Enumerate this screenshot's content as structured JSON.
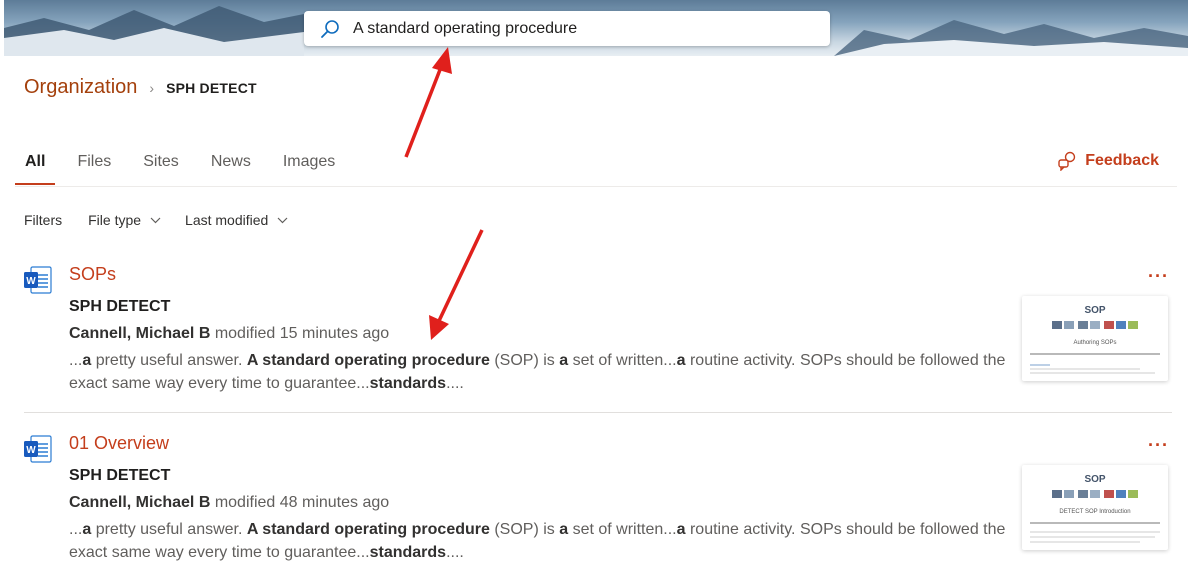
{
  "search": {
    "query": "A standard operating procedure"
  },
  "breadcrumb": {
    "root": "Organization",
    "separator": "›",
    "current": "SPH DETECT"
  },
  "tabs": [
    {
      "label": "All",
      "active": true
    },
    {
      "label": "Files",
      "active": false
    },
    {
      "label": "Sites",
      "active": false
    },
    {
      "label": "News",
      "active": false
    },
    {
      "label": "Images",
      "active": false
    }
  ],
  "feedback": {
    "label": "Feedback",
    "icon": "feedback-icon"
  },
  "filters": {
    "label": "Filters",
    "file_type": "File type",
    "last_modified": "Last modified"
  },
  "results": [
    {
      "title": "SOPs",
      "site": "SPH DETECT",
      "author": "Cannell, Michael B",
      "modified": " modified 15 minutes ago",
      "snippet_parts": [
        "...",
        "a",
        " pretty useful answer. ",
        "A standard operating procedure",
        " (SOP) is ",
        "a",
        " set of written...",
        "a",
        " routine activity. SOPs should be followed the exact same way every time to guarantee...",
        "standards",
        "...."
      ],
      "more": "···",
      "thumb_title": "SOP",
      "thumb_sub": "Authoring SOPs"
    },
    {
      "title": "01 Overview",
      "site": "SPH DETECT",
      "author": "Cannell, Michael B",
      "modified": " modified 48 minutes ago",
      "snippet_parts": [
        "...",
        "a",
        " pretty useful answer. ",
        "A standard operating procedure",
        " (SOP) is ",
        "a",
        " set of written...",
        "a",
        " routine activity. SOPs should be followed the exact same way every time to guarantee...",
        "standards",
        "...."
      ],
      "more": "···",
      "thumb_title": "SOP",
      "thumb_sub": "DETECT SOP Introduction"
    }
  ],
  "colors": {
    "accent": "#c43e1c",
    "breadcrumb": "#a4400c",
    "annotation_arrow": "#e0201c"
  }
}
